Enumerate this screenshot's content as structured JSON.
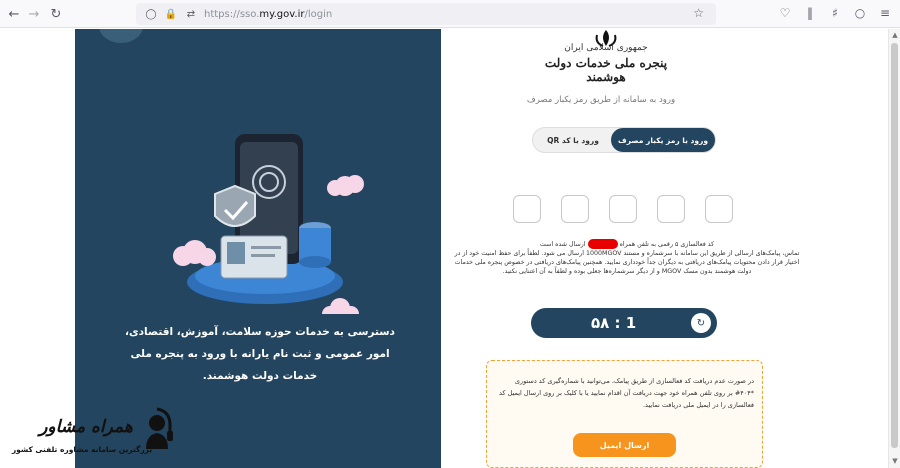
{
  "browser": {
    "url_prefix": "https://sso.",
    "url_domain": "my.gov.ir",
    "url_path": "/login",
    "nav_icons": [
      "back-icon",
      "forward-icon",
      "reload-icon"
    ],
    "right_icons": [
      "pocket-icon",
      "library-icon",
      "extensions-icon",
      "profile-icon",
      "menu-icon"
    ]
  },
  "left_panel": {
    "description": "دسترسی به خدمات حوزه سلامت، آموزش، اقتصادی، امور عمومی و ثبت نام یارانه با ورود به پنجره ملی خدمات دولت هوشمند."
  },
  "logo": {
    "line1": "جمهوری اسلامی ایران",
    "line2": "پنجره ملی خدمات دولت هوشمند"
  },
  "login": {
    "subtitle": "ورود به سامانه از طریق رمز یکبار مصرف",
    "tab_active": "ورود با رمز یکبار مصرف",
    "tab_inactive": "ورود با کد QR",
    "message_part1": "کد فعالسازی ۵ رقمی به تلفن همراه",
    "message_part2": "ارسال شده است",
    "message_rest": "تماس، پیامک‌های ارسالی از طریق این سامانه با سرشماره و مستند 1000MGOV ارسال می شود. لطفاً برای حفظ امنیت خود از در اختیار قرار دادن محتویات پیامک‌های دریافتی به دیگران جداً خودداری نمایید. همچنین پیامک‌های دریافتی در خصوص پنجره ملی خدمات دولت هوشمند بدون مسک MGOV و از دیگر سرشماره‌ها جعلی بوده و لطفاً به آن اعتنایی نکنید.",
    "timer": "۵۸ : 1",
    "notice": "در صورت عدم دریافت کد فعالسازی از طریق پیامک، می‌توانید با شماره‌گیری کد دستوری *۴۰۴# بر روی تلفن همراه خود جهت دریافت آن اقدام نمایید یا با کلیک بر روی ارسال ایمیل کد فعالسازی را در ایمیل ملی دریافت نمایید.",
    "email_button": "ارسال ایمیل"
  },
  "watermark": {
    "name": "همراه مشاور",
    "subtitle": "بزرگترین سامانه مشاوره تلفنی کشور"
  },
  "colors": {
    "primary": "#23455f",
    "accent": "#f7941d",
    "redaction": "#e60000"
  }
}
